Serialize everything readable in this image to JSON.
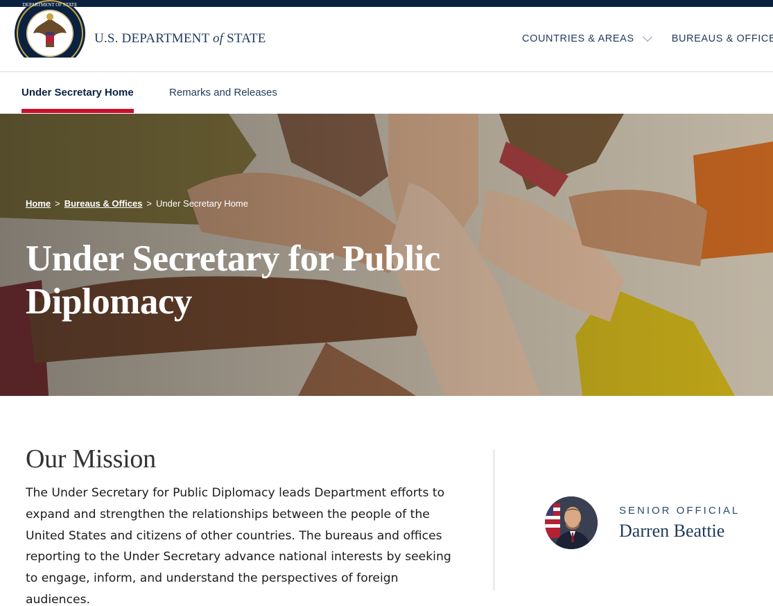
{
  "header": {
    "brand_main": "U.S. DEPARTMENT ",
    "brand_of": "of",
    "brand_end": " STATE",
    "seal_text": "DEPARTMENT OF STATE · UNITED STATES OF AMERICA",
    "nav": [
      {
        "label": "COUNTRIES & AREAS",
        "icon": "chevron-down-icon"
      },
      {
        "label": "BUREAUS & OFFICES"
      }
    ]
  },
  "subnav": {
    "tabs": [
      {
        "label": "Under Secretary Home",
        "active": true
      },
      {
        "label": "Remarks and Releases",
        "active": false
      }
    ]
  },
  "hero": {
    "breadcrumb": {
      "home": "Home",
      "sep1": ">",
      "bureaus": "Bureaus & Offices",
      "sep2": ">",
      "current": "Under Secretary Home"
    },
    "title": "Under Secretary for Public Diplomacy"
  },
  "mission": {
    "heading": "Our Mission",
    "body": "The Under Secretary for Public Diplomacy leads Department efforts to expand and strengthen the relationships between the people of the United States and citizens of other countries. The bureaus and offices reporting to the Under Secretary advance national interests by seeking to engage, inform, and understand the perspectives of foreign audiences."
  },
  "official": {
    "role": "SENIOR OFFICIAL",
    "name": "Darren Beattie"
  },
  "colors": {
    "navy": "#0a2240",
    "accent_red": "#c8102e",
    "text_blue": "#1f3a5a"
  }
}
